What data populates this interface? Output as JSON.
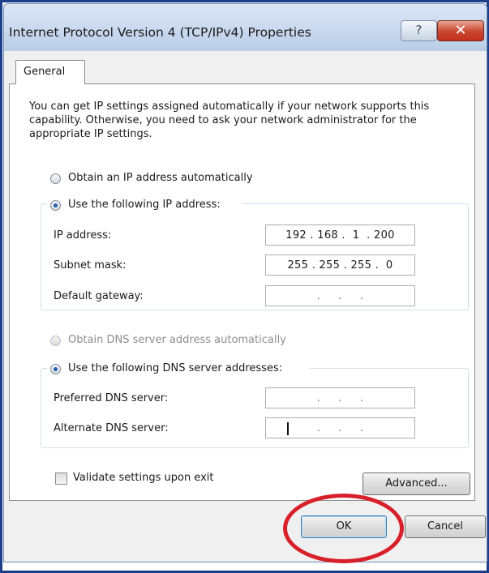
{
  "window": {
    "title": "Internet Protocol Version 4 (TCP/IPv4) Properties",
    "help_glyph": "?",
    "close_glyph": "✕"
  },
  "tabs": [
    {
      "label": "General",
      "active": true
    }
  ],
  "intro": "You can get IP settings assigned automatically if your network supports this capability. Otherwise, you need to ask your network administrator for the appropriate IP settings.",
  "ip": {
    "auto_label": "Obtain an IP address automatically",
    "manual_label": "Use the following IP address:",
    "selected": "manual",
    "fields": [
      {
        "label": "IP address:",
        "value": "192 . 168 .  1  . 200"
      },
      {
        "label": "Subnet mask:",
        "value": "255 . 255 . 255 .  0"
      },
      {
        "label": "Default gateway:",
        "value": ".     .     ."
      }
    ]
  },
  "dns": {
    "auto_label": "Obtain DNS server address automatically",
    "auto_disabled": true,
    "manual_label": "Use the following DNS server addresses:",
    "selected": "manual",
    "fields": [
      {
        "label": "Preferred DNS server:",
        "value": ".     .     ."
      },
      {
        "label": "Alternate DNS server:",
        "value": ".     .     ."
      }
    ]
  },
  "validate_label": "Validate settings upon exit",
  "validate_checked": false,
  "buttons": {
    "advanced": "Advanced...",
    "ok": "OK",
    "cancel": "Cancel"
  },
  "colors": {
    "highlight_ring": "#d8202b",
    "title_bar": "#c9d9ee",
    "radio_dot": "#1e5fb5"
  }
}
